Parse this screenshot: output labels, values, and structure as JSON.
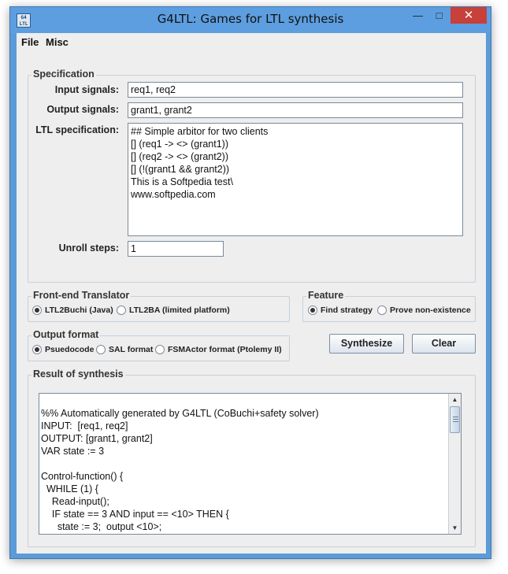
{
  "window": {
    "title": "G4LTL: Games for LTL synthesis",
    "icon_text": "G4\nLTL",
    "controls": {
      "minimize": "—",
      "maximize": "□",
      "close": "✕"
    }
  },
  "menu": {
    "items": [
      "File",
      "Misc"
    ]
  },
  "specification": {
    "title": "Specification",
    "input_label": "Input signals:",
    "input_value": "req1, req2",
    "output_label": "Output signals:",
    "output_value": "grant1, grant2",
    "ltl_label": "LTL specification:",
    "ltl_lines": [
      "## Simple arbitor for two clients",
      "[] (req1 -> <> (grant1))",
      "[] (req2 -> <> (grant2))",
      "[] (!(grant1 && grant2))",
      "This is a Softpedia test\\",
      "www.softpedia.com"
    ],
    "unroll_label": "Unroll steps:",
    "unroll_value": "1"
  },
  "frontend": {
    "title": "Front-end Translator",
    "options": [
      {
        "label": "LTL2Buchi (Java)",
        "selected": true
      },
      {
        "label": "LTL2BA (limited platform)",
        "selected": false
      }
    ]
  },
  "feature": {
    "title": "Feature",
    "options": [
      {
        "label": "Find strategy",
        "selected": true
      },
      {
        "label": "Prove non-existence",
        "selected": false
      }
    ]
  },
  "output_format": {
    "title": "Output format",
    "options": [
      {
        "label": "Psuedocode",
        "selected": true
      },
      {
        "label": "SAL format",
        "selected": false
      },
      {
        "label": "FSMActor format (Ptolemy II)",
        "selected": false
      }
    ]
  },
  "buttons": {
    "synthesize": "Synthesize",
    "clear": "Clear"
  },
  "result": {
    "title": "Result of synthesis",
    "lines": [
      "",
      "%% Automatically generated by G4LTL (CoBuchi+safety solver)",
      "INPUT:  [req1, req2]",
      "OUTPUT: [grant1, grant2]",
      "VAR state := 3",
      "",
      "Control-function() {",
      "  WHILE (1) {",
      "    Read-input();",
      "    IF state == 3 AND input == <10> THEN {",
      "      state := 3;  output <10>;"
    ]
  },
  "colors": {
    "titlebar": "#5d9ee0",
    "close_button": "#c7403a",
    "client_bg": "#eeeeee"
  }
}
